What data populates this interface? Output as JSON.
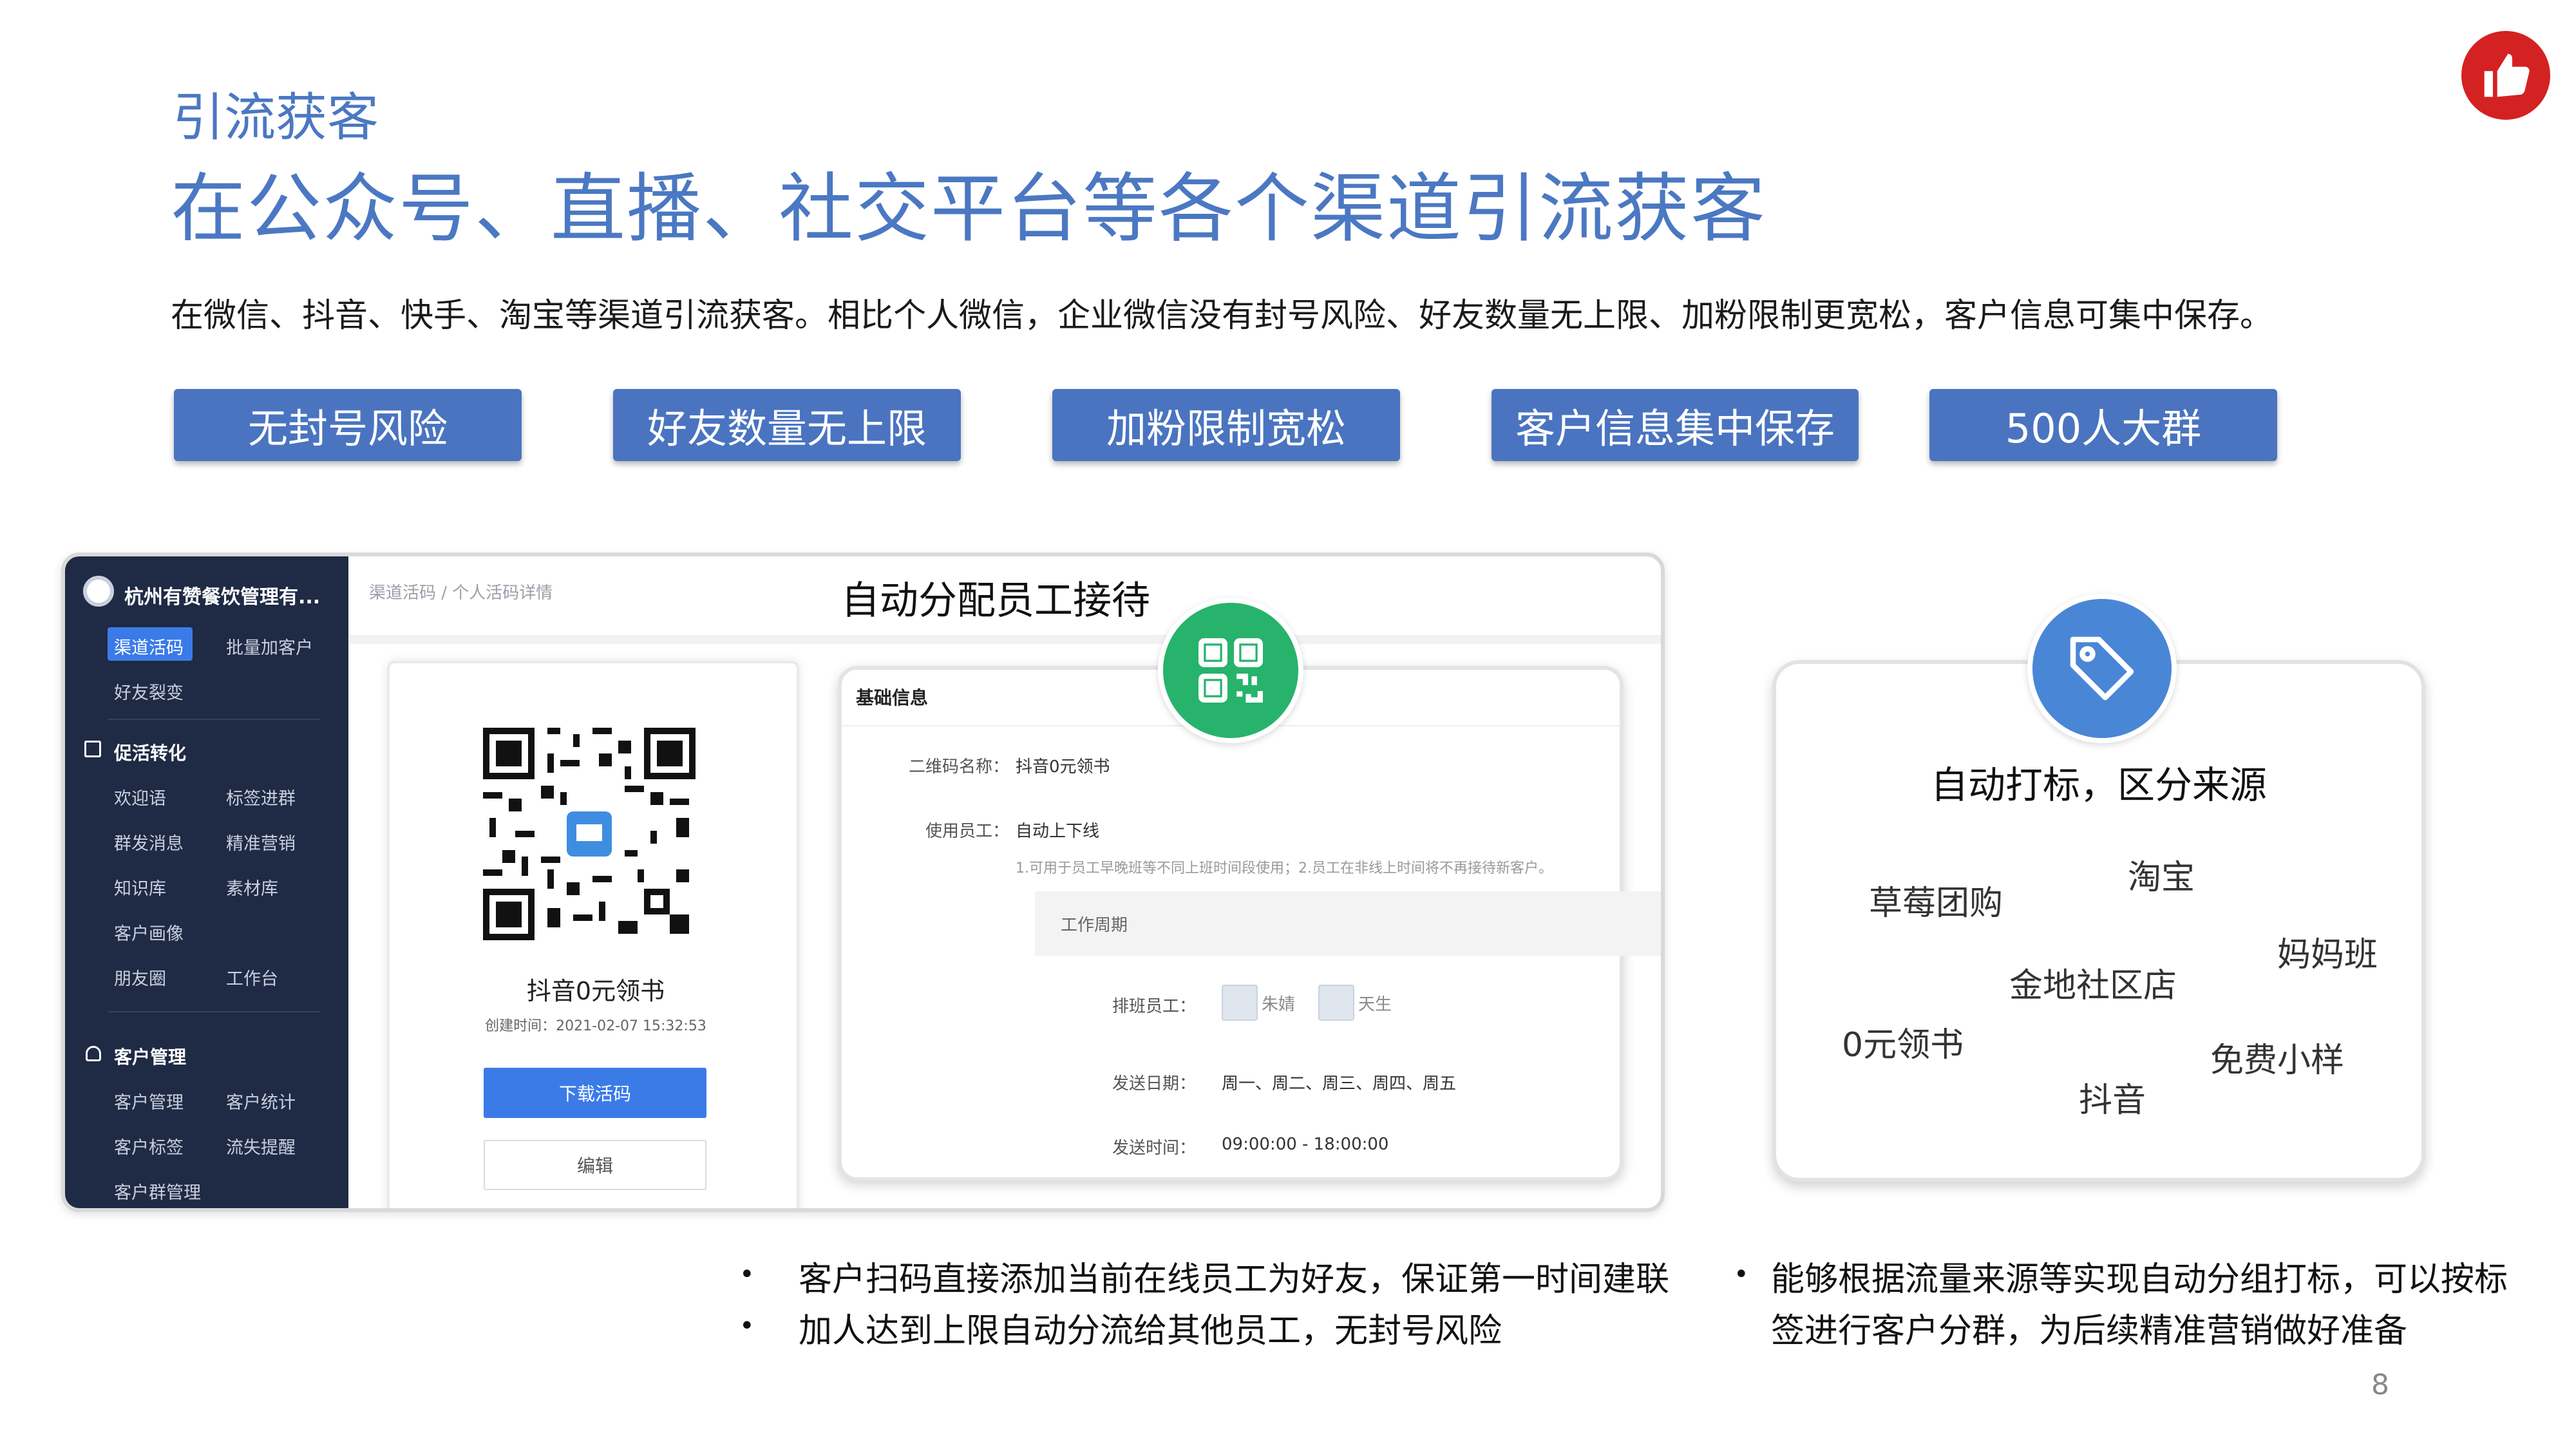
{
  "header": {
    "subtitle": "引流获客",
    "title": "在公众号、直播、社交平台等各个渠道引流获客",
    "description": "在微信、抖音、快手、淘宝等渠道引流获客。相比个人微信，企业微信没有封号风险、好友数量无上限、加粉限制更宽松，客户信息可集中保存。",
    "badge_icon": "thumbs-up-icon"
  },
  "features": [
    "无封号风险",
    "好友数量无上限",
    "加粉限制宽松",
    "客户信息集中保存",
    "500人大群"
  ],
  "screenshot": {
    "heading": "自动分配员工接待",
    "company": "杭州有赞餐饮管理有...",
    "breadcrumb": "渠道活码 / 个人活码详情",
    "sidebar": {
      "top_items": [
        "渠道活码",
        "批量加客户",
        "好友裂变"
      ],
      "sections": [
        {
          "title": "促活转化",
          "icon": "checklist-icon",
          "items": [
            "欢迎语",
            "标签进群",
            "群发消息",
            "精准营销",
            "知识库",
            "素材库",
            "客户画像",
            "朋友圈",
            "工作台"
          ]
        },
        {
          "title": "客户管理",
          "icon": "user-icon",
          "items": [
            "客户管理",
            "客户统计",
            "客户标签",
            "流失提醒",
            "客户群管理"
          ]
        }
      ]
    },
    "qr_card": {
      "name": "抖音0元领书",
      "created": "创建时间：2021-02-07 15:32:53",
      "download_label": "下载活码",
      "edit_label": "编辑"
    },
    "info": {
      "section_title": "基础信息",
      "qr_name_label": "二维码名称：",
      "qr_name_value": "抖音0元领书",
      "staff_label": "使用员工：",
      "staff_value": "自动上下线",
      "note": "1.可用于员工早晚班等不同上班时间段使用；2.员工在非线上时间将不再接待新客户。",
      "work_period": "工作周期",
      "schedule_label": "排班员工：",
      "employees": [
        "朱婧",
        "天生"
      ],
      "date_label": "发送日期：",
      "date_value": "周一、周二、周三、周四、周五",
      "time_label": "发送时间：",
      "time_value": "09:00:00 - 18:00:00"
    },
    "circle_icon": "qr-code-icon"
  },
  "tag_panel": {
    "title": "自动打标，区分来源",
    "icon": "tag-icon",
    "sources": [
      "草莓团购",
      "淘宝",
      "妈妈班",
      "金地社区店",
      "0元领书",
      "免费小样",
      "抖音"
    ]
  },
  "bullets_left": [
    "客户扫码直接添加当前在线员工为好友，保证第一时间建联",
    "加人达到上限自动分流给其他员工，无封号风险"
  ],
  "bullets_right": {
    "line1": "能够根据流量来源等实现自动分组打标，可以按标",
    "line2": "签进行客户分群，为后续精准营销做好准备"
  },
  "page_number": "8",
  "colors": {
    "accent": "#4b78c2",
    "button": "#4a74c0",
    "sidebar": "#1f2a44",
    "green": "#27b36b",
    "blue_circle": "#4a86d6",
    "badge": "#d42121"
  }
}
